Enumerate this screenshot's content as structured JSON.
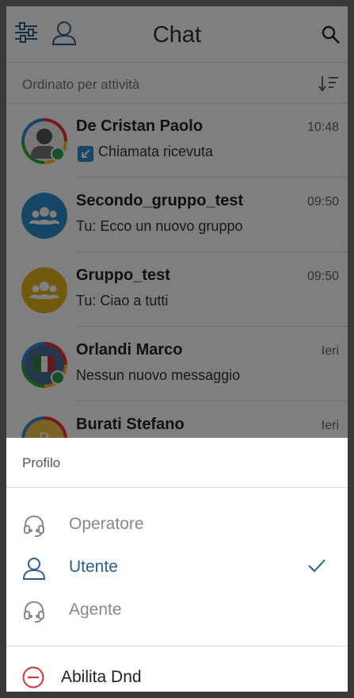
{
  "header": {
    "title": "Chat"
  },
  "sort": {
    "label": "Ordinato per attività"
  },
  "chats": [
    {
      "name": "De Cristan Paolo",
      "time": "10:48",
      "preview": "Chiamata ricevuta"
    },
    {
      "name": "Secondo_gruppo_test",
      "time": "09:50",
      "preview": "Tu: Ecco un nuovo gruppo"
    },
    {
      "name": "Gruppo_test",
      "time": "09:50",
      "preview": "Tu: Ciao a tutti"
    },
    {
      "name": "Orlandi Marco",
      "time": "Ieri",
      "preview": "Nessun nuovo messaggio"
    },
    {
      "name": "Burati Stefano",
      "time": "Ieri",
      "preview": "",
      "initial": "B"
    }
  ],
  "profile_sheet": {
    "title": "Profilo",
    "options": [
      {
        "label": "Operatore",
        "selected": false
      },
      {
        "label": "Utente",
        "selected": true
      },
      {
        "label": "Agente",
        "selected": false
      }
    ],
    "dnd_label": "Abilita Dnd"
  },
  "colors": {
    "accent": "#2a5f86",
    "group_blue": "#2f8fcf",
    "group_yellow": "#e7b21d",
    "online": "#2ea44f",
    "dnd_red": "#d6323a"
  }
}
